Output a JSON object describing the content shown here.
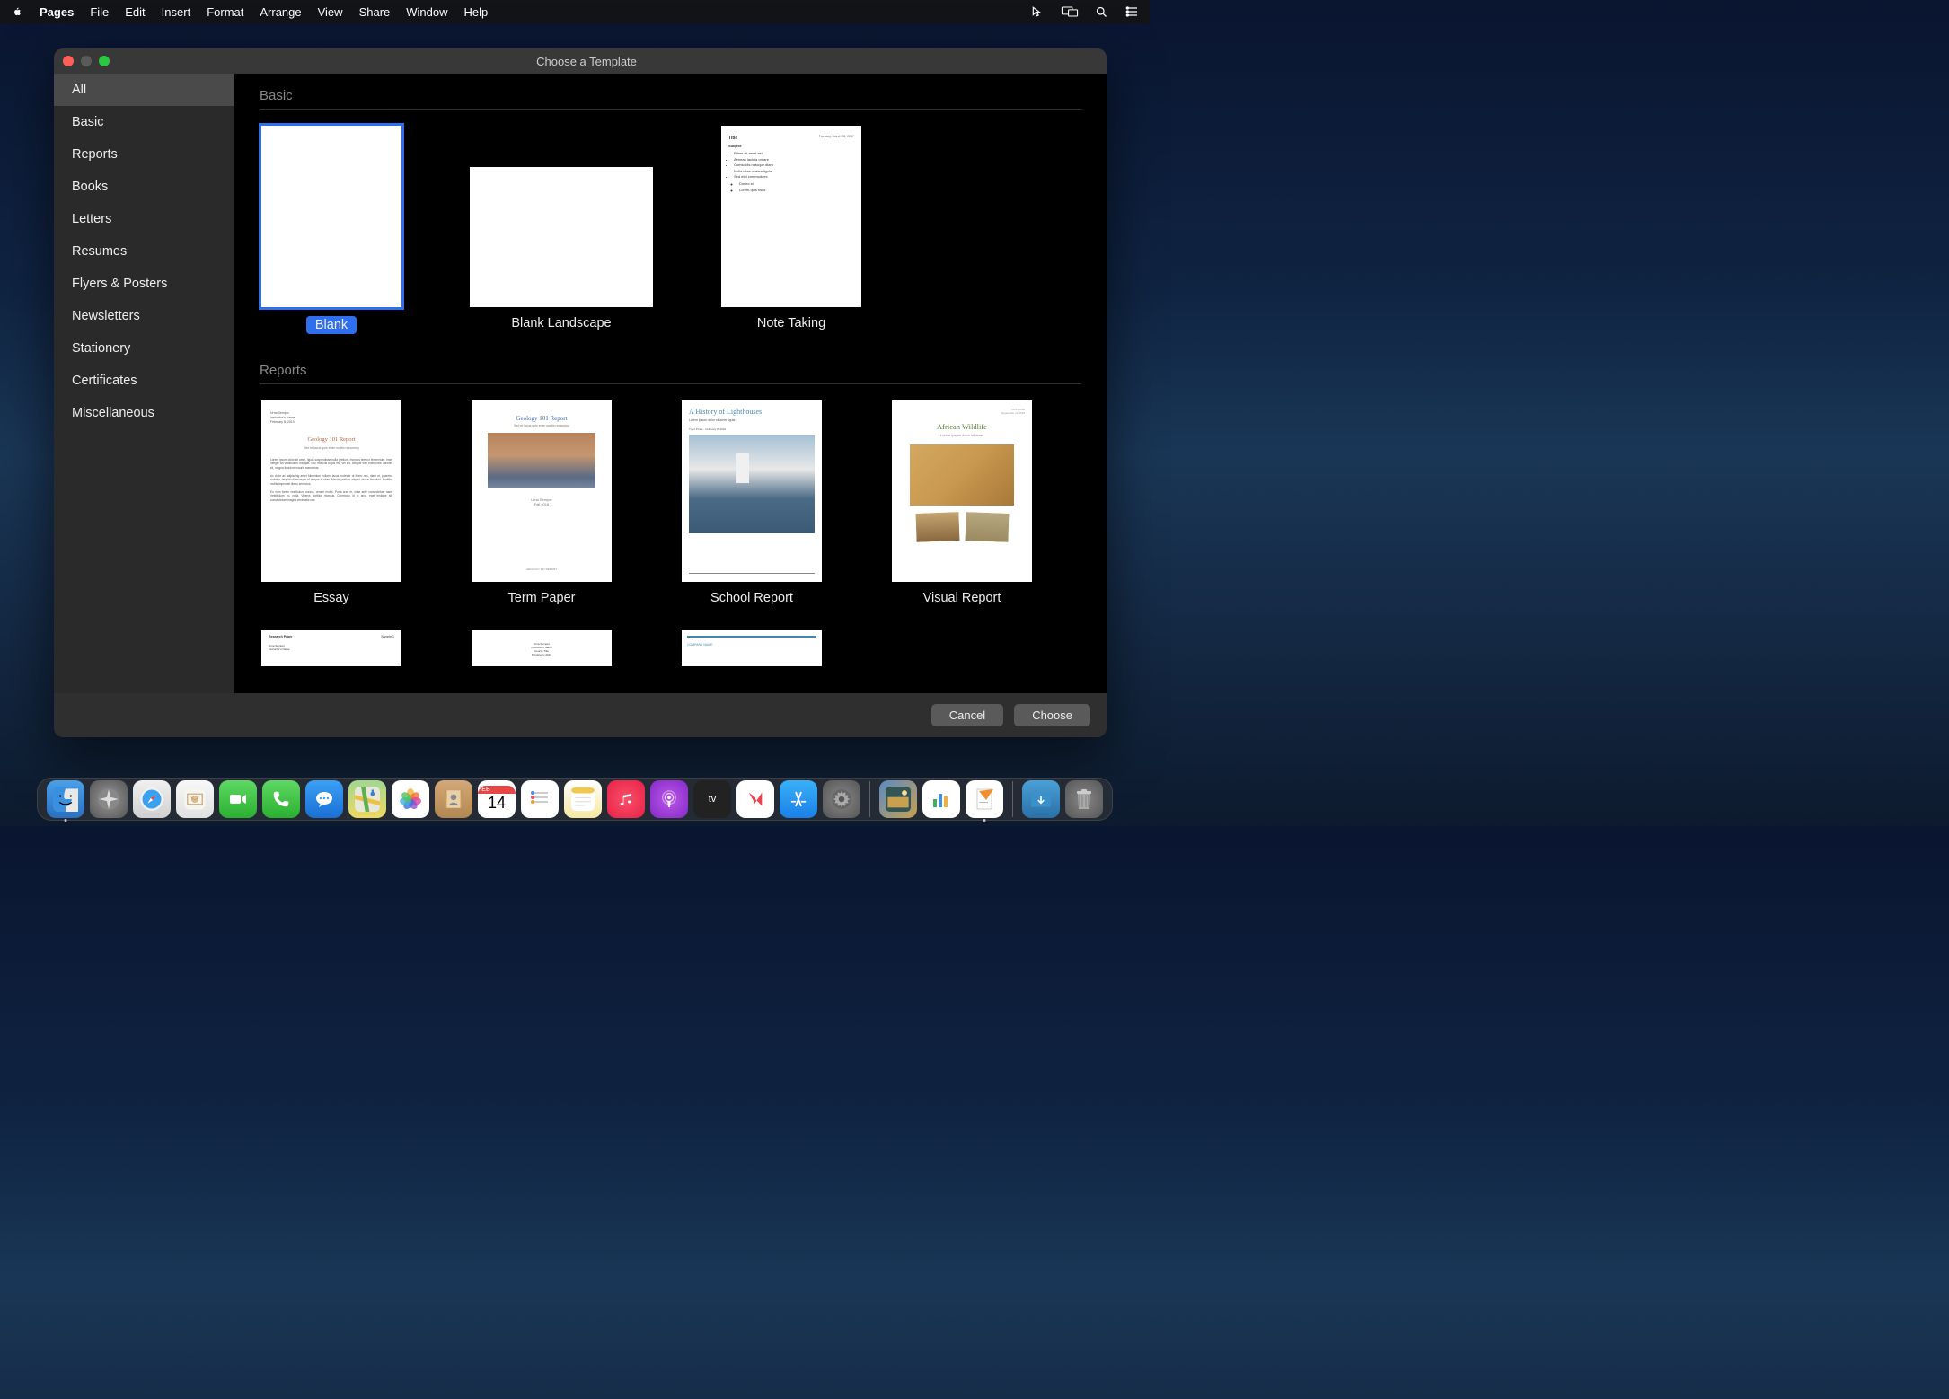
{
  "menubar": {
    "app": "Pages",
    "items": [
      "File",
      "Edit",
      "Insert",
      "Format",
      "Arrange",
      "View",
      "Share",
      "Window",
      "Help"
    ]
  },
  "window": {
    "title": "Choose a Template",
    "sidebar": {
      "items": [
        "All",
        "Basic",
        "Reports",
        "Books",
        "Letters",
        "Resumes",
        "Flyers & Posters",
        "Newsletters",
        "Stationery",
        "Certificates",
        "Miscellaneous"
      ],
      "selected": 0
    },
    "sections": [
      {
        "title": "Basic",
        "templates": [
          {
            "label": "Blank",
            "selected": true,
            "orientation": "portrait"
          },
          {
            "label": "Blank Landscape",
            "selected": false,
            "orientation": "landscape"
          },
          {
            "label": "Note Taking",
            "selected": false,
            "orientation": "portrait"
          }
        ]
      },
      {
        "title": "Reports",
        "templates": [
          {
            "label": "Essay",
            "selected": false,
            "orientation": "portrait"
          },
          {
            "label": "Term Paper",
            "selected": false,
            "orientation": "portrait"
          },
          {
            "label": "School Report",
            "selected": false,
            "orientation": "portrait"
          },
          {
            "label": "Visual Report",
            "selected": false,
            "orientation": "portrait"
          }
        ]
      }
    ],
    "buttons": {
      "cancel": "Cancel",
      "choose": "Choose"
    }
  },
  "thumb_text": {
    "note_taking": {
      "title": "Title",
      "subject": "Subject",
      "date": "Tuesday, March 28, 2017"
    },
    "essay": {
      "title": "Geology 101 Report",
      "subtitle": "Sed et lacus quis enim mattis nonummy"
    },
    "term_paper": {
      "title": "Geology 101 Report",
      "subtitle": "Sed et lacus quis enim mattis nonummy",
      "author": "Urna Semper",
      "term": "Fall 2018"
    },
    "school_report": {
      "title": "A History of Lighthouses",
      "subtitle": "Lorem ipsum dolor sit amet ligula",
      "byline": "Trent Pruce · February 8, 2019"
    },
    "visual_report": {
      "title": "African Wildlife",
      "subtitle": "Lorem ipsum dolor sit amet"
    },
    "research_paper": {
      "left": "Research Paper",
      "right": "Sample 1"
    }
  },
  "calendar": {
    "month": "FEB",
    "day": "14"
  },
  "dock": {
    "items": [
      "finder",
      "launchpad",
      "safari",
      "mail",
      "facetime",
      "messages",
      "chat",
      "maps",
      "photos",
      "contacts",
      "calendar",
      "reminders",
      "notes",
      "music",
      "podcasts",
      "tv",
      "news",
      "appstore",
      "settings"
    ],
    "right": [
      "photos2",
      "numbers",
      "pages"
    ],
    "far_right": [
      "downloads",
      "trash"
    ]
  }
}
